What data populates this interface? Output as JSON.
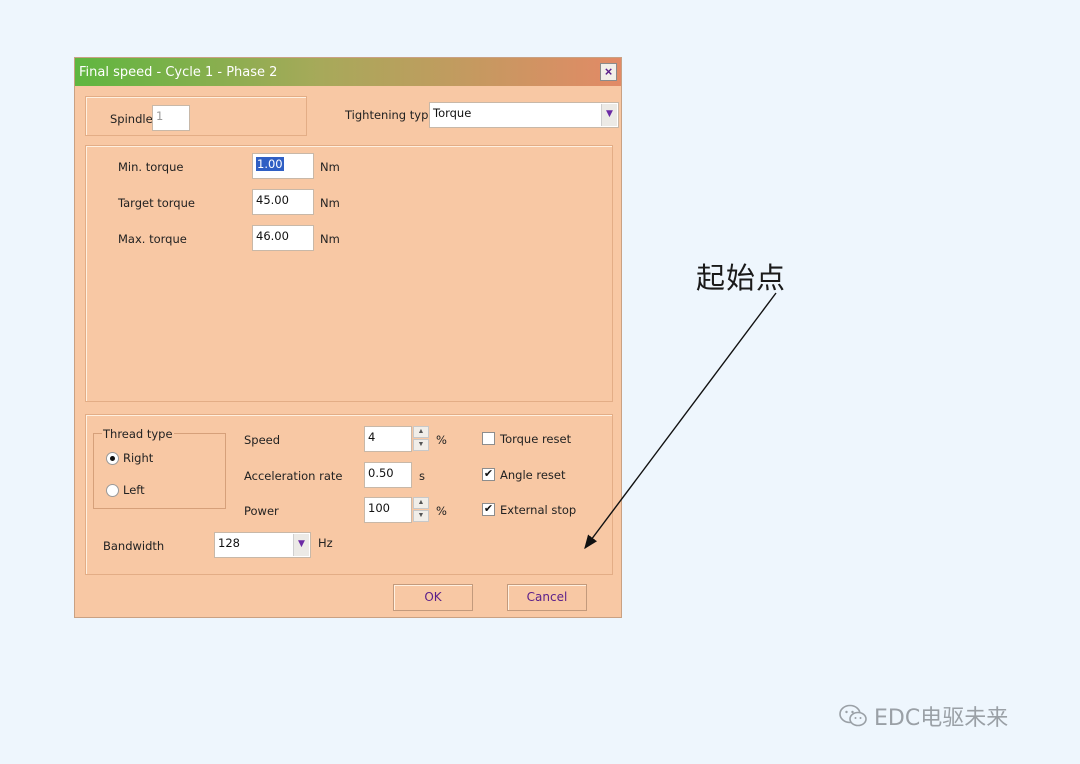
{
  "dialog": {
    "title": "Final speed - Cycle 1 - Phase 2",
    "close_symbol": "×"
  },
  "spindle": {
    "label": "Spindle",
    "value": "1"
  },
  "tightening": {
    "label": "Tightening type",
    "value": "Torque"
  },
  "torque": {
    "rows": [
      {
        "label": "Min. torque",
        "value": "1.00",
        "unit": "Nm"
      },
      {
        "label": "Target torque",
        "value": "45.00",
        "unit": "Nm"
      },
      {
        "label": "Max. torque",
        "value": "46.00",
        "unit": "Nm"
      }
    ]
  },
  "thread": {
    "title": "Thread type",
    "options": [
      {
        "label": "Right",
        "selected": true
      },
      {
        "label": "Left",
        "selected": false
      }
    ]
  },
  "motion": {
    "rows": [
      {
        "label": "Speed",
        "value": "4",
        "unit": "%",
        "spinner": true
      },
      {
        "label": "Acceleration rate",
        "value": "0.50",
        "unit": "s",
        "spinner": false
      },
      {
        "label": "Power",
        "value": "100",
        "unit": "%",
        "spinner": true
      }
    ]
  },
  "checks": [
    {
      "label": "Torque reset",
      "checked": false
    },
    {
      "label": "Angle reset",
      "checked": true
    },
    {
      "label": "External stop",
      "checked": true
    }
  ],
  "bandwidth": {
    "label": "Bandwidth",
    "value": "128",
    "unit": "Hz"
  },
  "buttons": {
    "ok": "OK",
    "cancel": "Cancel"
  },
  "annotation": {
    "text": "起始点"
  },
  "watermark": {
    "text": "EDC电驱未来",
    "icon": "wechat-icon"
  },
  "colors": {
    "dialog_bg": "#f8c8a4",
    "title_gradient_start": "#5fb63f",
    "title_gradient_end": "#e28a66",
    "button_text": "#5a1e8a",
    "page_bg": "#eef6fd"
  }
}
